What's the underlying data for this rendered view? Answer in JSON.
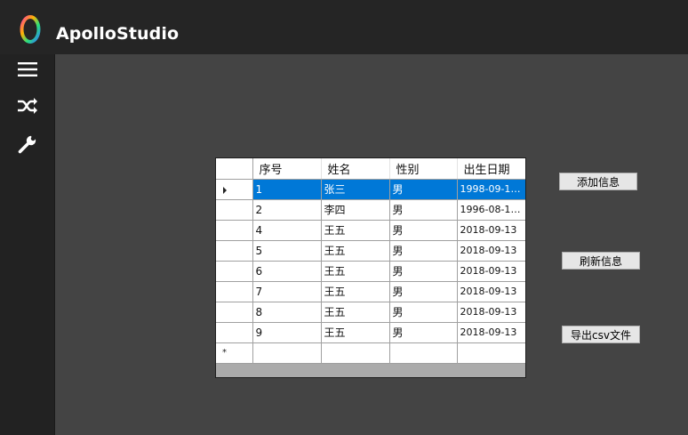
{
  "app": {
    "title": "ApolloStudio"
  },
  "sidebar": {
    "items": [
      {
        "icon": "hamburger-menu-icon"
      },
      {
        "icon": "shuffle-icon"
      },
      {
        "icon": "wrench-icon"
      }
    ]
  },
  "table": {
    "headers": [
      "序号",
      "姓名",
      "性别",
      "出生日期"
    ],
    "rows": [
      {
        "id": "1",
        "name": "张三",
        "gender": "男",
        "birth": "1998-09-11 ..."
      },
      {
        "id": "2",
        "name": "李四",
        "gender": "男",
        "birth": "1996-08-10 ..."
      },
      {
        "id": "4",
        "name": "王五",
        "gender": "男",
        "birth": "2018-09-13"
      },
      {
        "id": "5",
        "name": "王五",
        "gender": "男",
        "birth": "2018-09-13"
      },
      {
        "id": "6",
        "name": "王五",
        "gender": "男",
        "birth": "2018-09-13"
      },
      {
        "id": "7",
        "name": "王五",
        "gender": "男",
        "birth": "2018-09-13"
      },
      {
        "id": "8",
        "name": "王五",
        "gender": "男",
        "birth": "2018-09-13"
      },
      {
        "id": "9",
        "name": "王五",
        "gender": "男",
        "birth": "2018-09-13"
      }
    ],
    "selected_row_marker": "▶",
    "new_row_marker": "*"
  },
  "buttons": {
    "add": "添加信息",
    "refresh": "刷新信息",
    "export": "导出csv文件"
  },
  "colors": {
    "titlebar": "#252525",
    "sidebar": "#222222",
    "content": "#444444",
    "selection": "#0078d7"
  }
}
